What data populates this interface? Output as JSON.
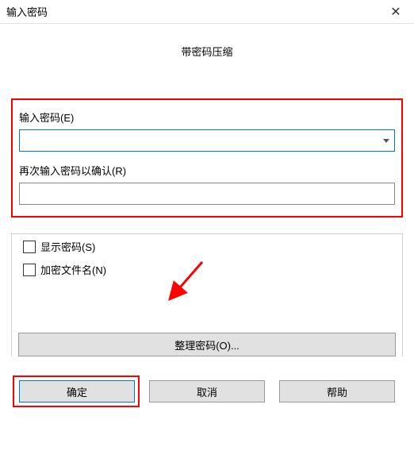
{
  "titlebar": {
    "title": "输入密码"
  },
  "subtitle": "带密码压缩",
  "fields": {
    "password_label": "输入密码(E)",
    "confirm_label": "再次输入密码以确认(R)"
  },
  "options": {
    "show_password": "显示密码(S)",
    "encrypt_filenames": "加密文件名(N)",
    "organize_button": "整理密码(O)..."
  },
  "buttons": {
    "ok": "确定",
    "cancel": "取消",
    "help": "帮助"
  },
  "colors": {
    "highlight": "#ff0000",
    "focus_border": "#0078d7"
  }
}
